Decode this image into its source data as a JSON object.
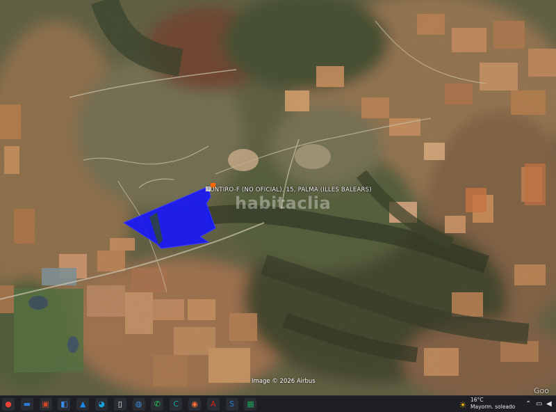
{
  "map": {
    "place_label": "PUNTIRO-F (NO OFICIAL), 15, PALMA (ILLES BALEARS)",
    "watermark": "habitaclia",
    "imagery_credit": "Image © 2026 Airbus",
    "provider_logo": "Goo",
    "parcel_color": "#1414ff",
    "marker_color": "#ff6a00"
  },
  "taskbar": {
    "weather_temp": "16°C",
    "weather_desc": "Mayorm. soleado",
    "apps": [
      {
        "name": "chrome-icon",
        "glyph": "●",
        "color": "#e94335"
      },
      {
        "name": "file-explorer-icon",
        "glyph": "▬",
        "color": "#2e7bd6"
      },
      {
        "name": "presentation-icon",
        "glyph": "▣",
        "color": "#d04a2a"
      },
      {
        "name": "remote-icon",
        "glyph": "◧",
        "color": "#3a8ee6"
      },
      {
        "name": "photos-icon",
        "glyph": "▲",
        "color": "#1e88e5"
      },
      {
        "name": "edge-icon",
        "glyph": "◕",
        "color": "#1aa0d8"
      },
      {
        "name": "document-icon",
        "glyph": "▯",
        "color": "#f0f0f0"
      },
      {
        "name": "globe-icon",
        "glyph": "◍",
        "color": "#3f8fd8"
      },
      {
        "name": "whatsapp-icon",
        "glyph": "✆",
        "color": "#25d366"
      },
      {
        "name": "app-c-icon",
        "glyph": "C",
        "color": "#14a89a"
      },
      {
        "name": "firefox-icon",
        "glyph": "◉",
        "color": "#ff7139"
      },
      {
        "name": "pdf-reader-icon",
        "glyph": "A",
        "color": "#d4231d"
      },
      {
        "name": "app-s-icon",
        "glyph": "S",
        "color": "#2a7dd6"
      },
      {
        "name": "spreadsheet-icon",
        "glyph": "▦",
        "color": "#1f9d55"
      }
    ]
  }
}
